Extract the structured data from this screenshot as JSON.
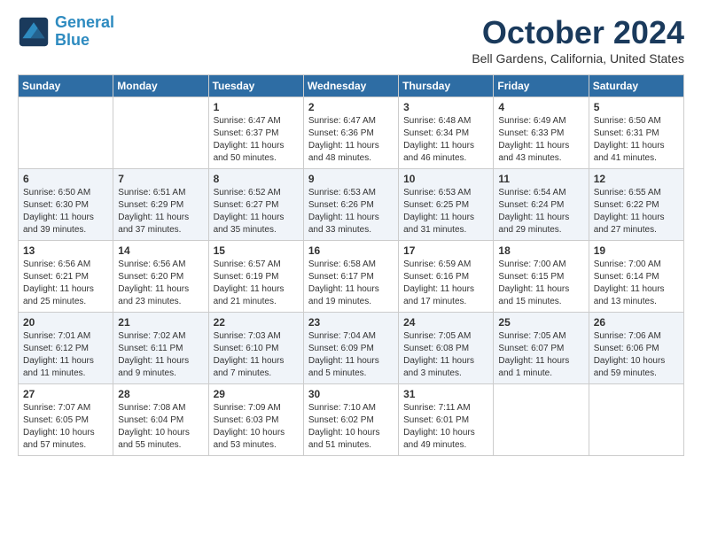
{
  "header": {
    "logo_line1": "General",
    "logo_line2": "Blue",
    "month_title": "October 2024",
    "location": "Bell Gardens, California, United States"
  },
  "weekdays": [
    "Sunday",
    "Monday",
    "Tuesday",
    "Wednesday",
    "Thursday",
    "Friday",
    "Saturday"
  ],
  "weeks": [
    [
      {
        "day": "",
        "info": ""
      },
      {
        "day": "",
        "info": ""
      },
      {
        "day": "1",
        "info": "Sunrise: 6:47 AM\nSunset: 6:37 PM\nDaylight: 11 hours and 50 minutes."
      },
      {
        "day": "2",
        "info": "Sunrise: 6:47 AM\nSunset: 6:36 PM\nDaylight: 11 hours and 48 minutes."
      },
      {
        "day": "3",
        "info": "Sunrise: 6:48 AM\nSunset: 6:34 PM\nDaylight: 11 hours and 46 minutes."
      },
      {
        "day": "4",
        "info": "Sunrise: 6:49 AM\nSunset: 6:33 PM\nDaylight: 11 hours and 43 minutes."
      },
      {
        "day": "5",
        "info": "Sunrise: 6:50 AM\nSunset: 6:31 PM\nDaylight: 11 hours and 41 minutes."
      }
    ],
    [
      {
        "day": "6",
        "info": "Sunrise: 6:50 AM\nSunset: 6:30 PM\nDaylight: 11 hours and 39 minutes."
      },
      {
        "day": "7",
        "info": "Sunrise: 6:51 AM\nSunset: 6:29 PM\nDaylight: 11 hours and 37 minutes."
      },
      {
        "day": "8",
        "info": "Sunrise: 6:52 AM\nSunset: 6:27 PM\nDaylight: 11 hours and 35 minutes."
      },
      {
        "day": "9",
        "info": "Sunrise: 6:53 AM\nSunset: 6:26 PM\nDaylight: 11 hours and 33 minutes."
      },
      {
        "day": "10",
        "info": "Sunrise: 6:53 AM\nSunset: 6:25 PM\nDaylight: 11 hours and 31 minutes."
      },
      {
        "day": "11",
        "info": "Sunrise: 6:54 AM\nSunset: 6:24 PM\nDaylight: 11 hours and 29 minutes."
      },
      {
        "day": "12",
        "info": "Sunrise: 6:55 AM\nSunset: 6:22 PM\nDaylight: 11 hours and 27 minutes."
      }
    ],
    [
      {
        "day": "13",
        "info": "Sunrise: 6:56 AM\nSunset: 6:21 PM\nDaylight: 11 hours and 25 minutes."
      },
      {
        "day": "14",
        "info": "Sunrise: 6:56 AM\nSunset: 6:20 PM\nDaylight: 11 hours and 23 minutes."
      },
      {
        "day": "15",
        "info": "Sunrise: 6:57 AM\nSunset: 6:19 PM\nDaylight: 11 hours and 21 minutes."
      },
      {
        "day": "16",
        "info": "Sunrise: 6:58 AM\nSunset: 6:17 PM\nDaylight: 11 hours and 19 minutes."
      },
      {
        "day": "17",
        "info": "Sunrise: 6:59 AM\nSunset: 6:16 PM\nDaylight: 11 hours and 17 minutes."
      },
      {
        "day": "18",
        "info": "Sunrise: 7:00 AM\nSunset: 6:15 PM\nDaylight: 11 hours and 15 minutes."
      },
      {
        "day": "19",
        "info": "Sunrise: 7:00 AM\nSunset: 6:14 PM\nDaylight: 11 hours and 13 minutes."
      }
    ],
    [
      {
        "day": "20",
        "info": "Sunrise: 7:01 AM\nSunset: 6:12 PM\nDaylight: 11 hours and 11 minutes."
      },
      {
        "day": "21",
        "info": "Sunrise: 7:02 AM\nSunset: 6:11 PM\nDaylight: 11 hours and 9 minutes."
      },
      {
        "day": "22",
        "info": "Sunrise: 7:03 AM\nSunset: 6:10 PM\nDaylight: 11 hours and 7 minutes."
      },
      {
        "day": "23",
        "info": "Sunrise: 7:04 AM\nSunset: 6:09 PM\nDaylight: 11 hours and 5 minutes."
      },
      {
        "day": "24",
        "info": "Sunrise: 7:05 AM\nSunset: 6:08 PM\nDaylight: 11 hours and 3 minutes."
      },
      {
        "day": "25",
        "info": "Sunrise: 7:05 AM\nSunset: 6:07 PM\nDaylight: 11 hours and 1 minute."
      },
      {
        "day": "26",
        "info": "Sunrise: 7:06 AM\nSunset: 6:06 PM\nDaylight: 10 hours and 59 minutes."
      }
    ],
    [
      {
        "day": "27",
        "info": "Sunrise: 7:07 AM\nSunset: 6:05 PM\nDaylight: 10 hours and 57 minutes."
      },
      {
        "day": "28",
        "info": "Sunrise: 7:08 AM\nSunset: 6:04 PM\nDaylight: 10 hours and 55 minutes."
      },
      {
        "day": "29",
        "info": "Sunrise: 7:09 AM\nSunset: 6:03 PM\nDaylight: 10 hours and 53 minutes."
      },
      {
        "day": "30",
        "info": "Sunrise: 7:10 AM\nSunset: 6:02 PM\nDaylight: 10 hours and 51 minutes."
      },
      {
        "day": "31",
        "info": "Sunrise: 7:11 AM\nSunset: 6:01 PM\nDaylight: 10 hours and 49 minutes."
      },
      {
        "day": "",
        "info": ""
      },
      {
        "day": "",
        "info": ""
      }
    ]
  ]
}
